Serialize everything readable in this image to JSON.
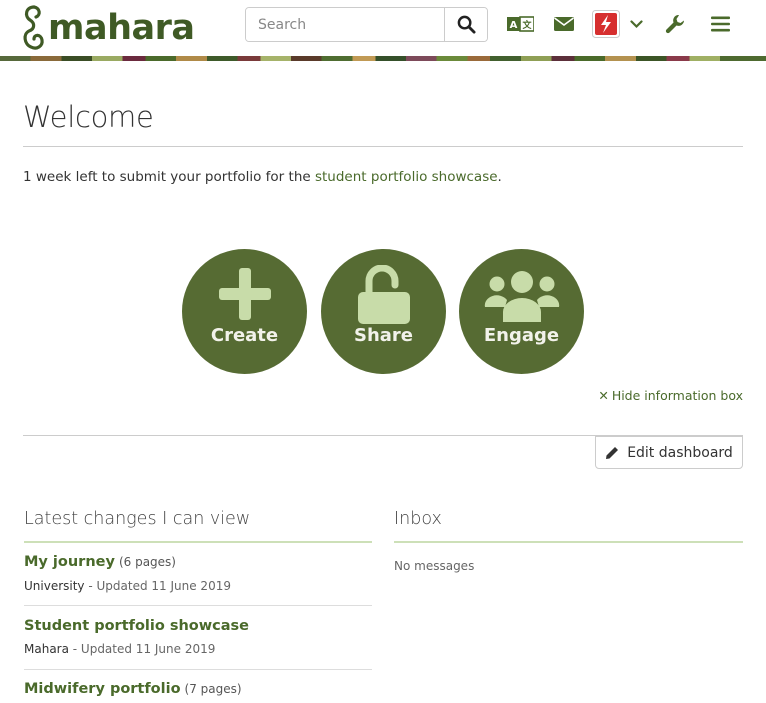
{
  "header": {
    "logo_text": "mahara",
    "search": {
      "placeholder": "Search"
    },
    "icons": [
      "language-icon",
      "mail-icon",
      "user-avatar-icon",
      "chevron-down-icon",
      "wrench-icon",
      "menu-icon"
    ]
  },
  "colors": {
    "brand_green": "#566b33",
    "link_green": "#4a6a2b",
    "block_rule": "#cde0b8"
  },
  "main": {
    "title": "Welcome",
    "notice": {
      "prefix": "1 week left to submit your portfolio for the ",
      "link": "student portfolio showcase",
      "suffix": "."
    },
    "actions": [
      {
        "label": "Create",
        "icon": "plus-icon"
      },
      {
        "label": "Share",
        "icon": "unlock-icon"
      },
      {
        "label": "Engage",
        "icon": "users-icon"
      }
    ],
    "hide_info_label": "Hide information box",
    "edit_dashboard_label": "Edit dashboard"
  },
  "latest_changes": {
    "title": "Latest changes I can view",
    "items": [
      {
        "title": "My journey",
        "count": "(6 pages)",
        "owner": "University",
        "updated": " - Updated 11 June 2019"
      },
      {
        "title": "Student portfolio showcase",
        "count": "",
        "owner": "Mahara",
        "updated": " - Updated 11 June 2019"
      },
      {
        "title": "Midwifery portfolio",
        "count": "(7 pages)",
        "owner": "",
        "updated": ""
      }
    ]
  },
  "inbox": {
    "title": "Inbox",
    "empty_text": "No messages"
  }
}
